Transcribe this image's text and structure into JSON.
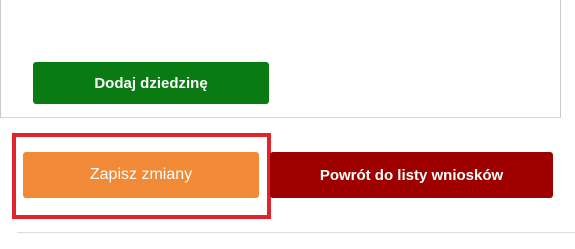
{
  "panel": {
    "add_domain_label": "Dodaj dziedzinę"
  },
  "actions": {
    "save_label": "Zapisz zmiany",
    "back_label": "Powrót do listy wniosków"
  },
  "colors": {
    "add_button": "#0a7a12",
    "save_button": "#f08a36",
    "back_button": "#9e0000",
    "highlight": "#e0242b"
  }
}
